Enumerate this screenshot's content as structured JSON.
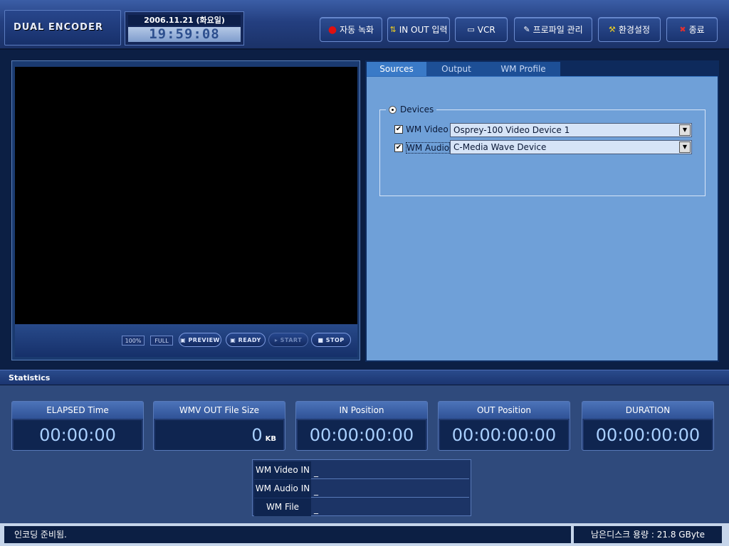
{
  "header": {
    "logo": "DUAL ENCODER",
    "date": "2006.11.21 (화요일)",
    "time": "19:59:08",
    "buttons": {
      "auto_record": "자동 녹화",
      "in_out": "IN OUT 입력",
      "vcr": "VCR",
      "profile": "프로파일 관리",
      "settings": "환경설정",
      "exit": "종료"
    }
  },
  "video": {
    "zoom_100": "100%",
    "full": "FULL",
    "preview": "PREVIEW",
    "ready": "READY",
    "start": "START",
    "stop": "STOP"
  },
  "settings": {
    "tabs": [
      "Sources",
      "Output",
      "WM Profile"
    ],
    "group_label": "Devices",
    "video_label": "WM Video",
    "video_device": "Osprey-100 Video Device 1",
    "audio_label": "WM Audio",
    "audio_device": "C-Media Wave Device"
  },
  "stats": {
    "title": "Statistics",
    "elapsed_label": "ELAPSED Time",
    "elapsed_value": "00:00:00",
    "size_label": "WMV OUT File Size",
    "size_value": "0",
    "size_unit": "KB",
    "in_label": "IN Position",
    "in_value": "00:00:00:00",
    "out_label": "OUT Position",
    "out_value": "00:00:00:00",
    "duration_label": "DURATION",
    "duration_value": "00:00:00:00",
    "io": [
      {
        "label": "WM Video IN",
        "value": "_"
      },
      {
        "label": "WM Audio IN",
        "value": "_"
      },
      {
        "label": "WM File",
        "value": "_"
      }
    ]
  },
  "status": {
    "message": "인코딩 준비됨.",
    "disk": "남은디스크 용량 : 21.8 GByte"
  }
}
